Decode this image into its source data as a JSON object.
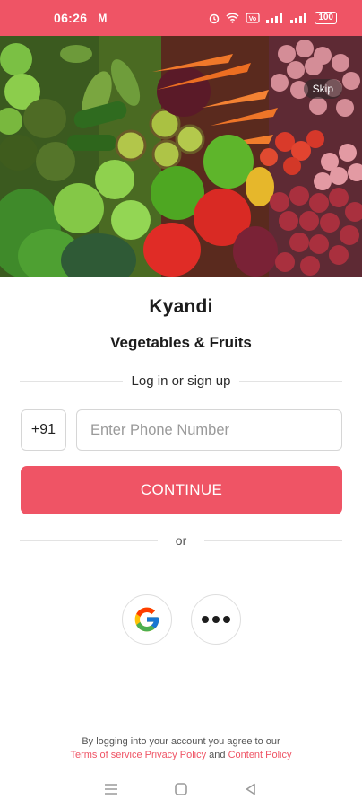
{
  "status_bar": {
    "time": "06:26",
    "app_icon": "M",
    "battery": "100",
    "icons": [
      "alarm-icon",
      "wifi-icon",
      "volte-icon",
      "signal-icon",
      "signal-icon",
      "battery-icon"
    ]
  },
  "hero": {
    "skip_label": "Skip"
  },
  "brand": {
    "name": "Kyandi",
    "subtitle": "Vegetables & Fruits"
  },
  "login": {
    "divider_text": "Log in or sign up",
    "country_code": "+91",
    "phone_placeholder": "Enter Phone Number",
    "continue_label": "CONTINUE",
    "or_text": "or"
  },
  "social": {
    "google_icon": "google-icon",
    "more_icon": "more-options-icon"
  },
  "legal": {
    "prefix": "By logging into your account you agree to our",
    "terms": "Terms of service",
    "privacy": "Privacy Policy",
    "and": "and",
    "content": "Content Policy"
  },
  "nav_bar": {
    "icons": [
      "menu-icon",
      "home-icon",
      "back-icon"
    ]
  },
  "colors": {
    "accent": "#ef5465",
    "text": "#1c1c1c",
    "border": "#d6d6d6"
  }
}
